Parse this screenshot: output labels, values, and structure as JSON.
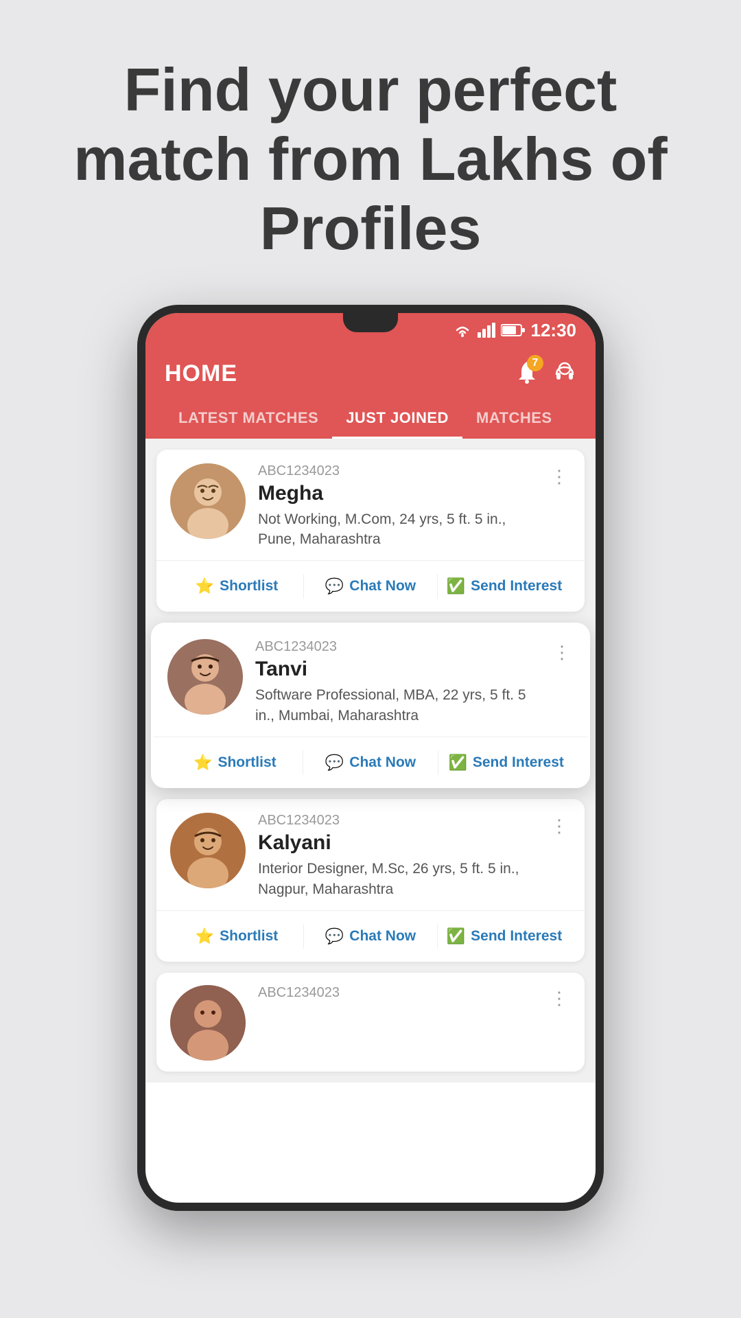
{
  "hero": {
    "title": "Find your perfect match from Lakhs of Profiles"
  },
  "phone": {
    "status_bar": {
      "time": "12:30",
      "notification_count": "7"
    },
    "header": {
      "title": "HOME",
      "tabs": [
        {
          "label": "LATEST MATCHES",
          "active": false
        },
        {
          "label": "JUST JOINED",
          "active": true
        },
        {
          "label": "MATCHES",
          "active": false
        }
      ]
    },
    "profiles": [
      {
        "id": "ABC1234023",
        "name": "Megha",
        "description": "Not Working, M.Com, 24 yrs, 5 ft. 5 in., Pune, Maharashtra",
        "avatar_color": "megha"
      },
      {
        "id": "ABC1234023",
        "name": "Tanvi",
        "description": "Software Professional, MBA, 22 yrs, 5 ft. 5 in., Mumbai, Maharashtra",
        "avatar_color": "tanvi",
        "floating": true
      },
      {
        "id": "ABC1234023",
        "name": "Kalyani",
        "description": "Interior Designer, M.Sc, 26 yrs, 5 ft. 5 in., Nagpur, Maharashtra",
        "avatar_color": "kalyani"
      },
      {
        "id": "ABC1234023",
        "name": "",
        "description": "",
        "avatar_color": "profile4",
        "partial": true
      }
    ],
    "actions": {
      "shortlist": "Shortlist",
      "chat_now": "Chat Now",
      "send_interest": "Send Interest"
    }
  }
}
